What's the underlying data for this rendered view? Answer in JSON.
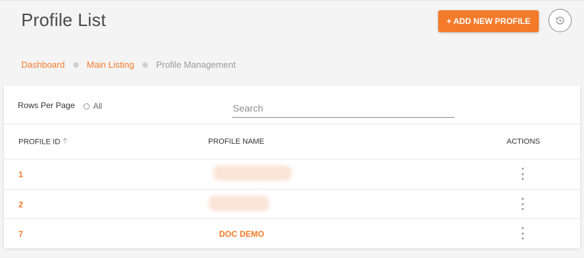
{
  "page": {
    "title": "Profile List",
    "add_button_label": "+ ADD NEW PROFILE",
    "history_icon": "history-icon"
  },
  "breadcrumb": {
    "items": [
      "Dashboard",
      "Main Listing",
      "Profile Management"
    ]
  },
  "colors": {
    "accent": "#f47b2a",
    "muted": "#9b9b9b"
  },
  "table": {
    "rows_per_page_label": "Rows Per Page",
    "rows_option_label": "All",
    "search_placeholder": "Search",
    "columns": [
      "PROFILE ID",
      "PROFILE NAME",
      "ACTIONS"
    ],
    "sort_icon": "arrow-up-icon",
    "rows": [
      {
        "id": "1",
        "name": ""
      },
      {
        "id": "2",
        "name": ""
      },
      {
        "id": "7",
        "name": "DOC DEMO"
      }
    ]
  }
}
